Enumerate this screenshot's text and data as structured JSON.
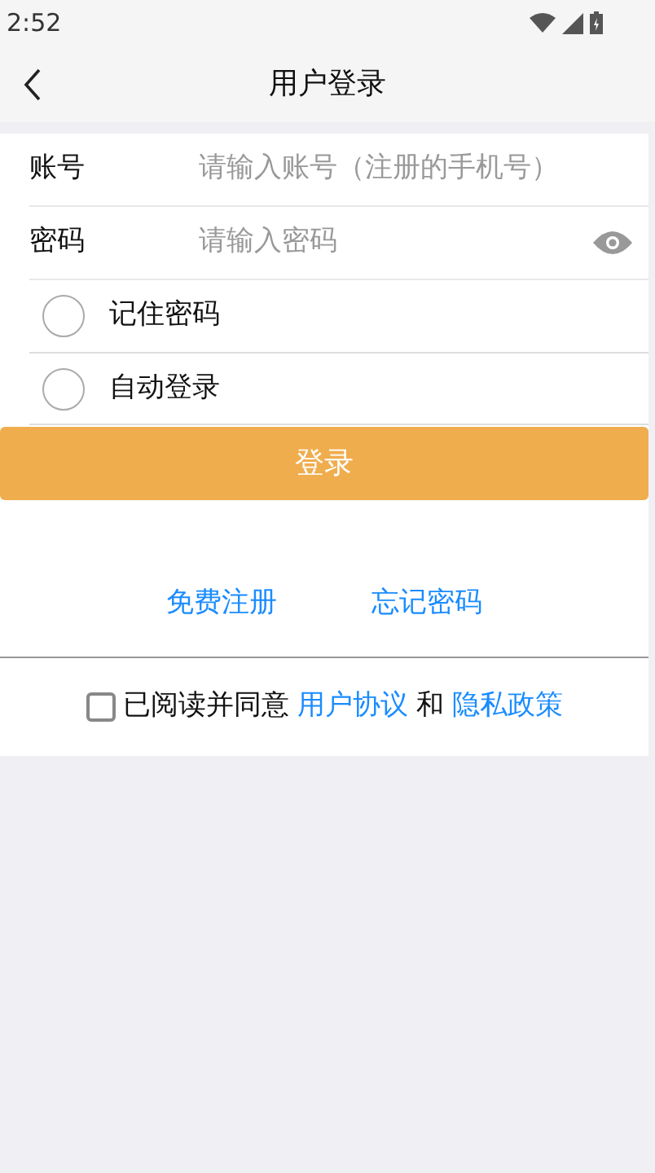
{
  "status_bar": {
    "time": "2:52"
  },
  "header": {
    "title": "用户登录"
  },
  "fields": [
    {
      "label": "账号",
      "placeholder": "请输入账号（注册的手机号）",
      "kind": "text"
    },
    {
      "label": "密码",
      "placeholder": "请输入密码",
      "kind": "password"
    }
  ],
  "options": [
    {
      "label": "记住密码",
      "checked": false
    },
    {
      "label": "自动登录",
      "checked": false
    }
  ],
  "login_button": "登录",
  "links": [
    "免费注册",
    "忘记密码"
  ],
  "agreement": {
    "checked": false,
    "text": "已阅读并同意",
    "link1": "用户协议",
    "joiner": "和",
    "link2": "隐私政策"
  }
}
